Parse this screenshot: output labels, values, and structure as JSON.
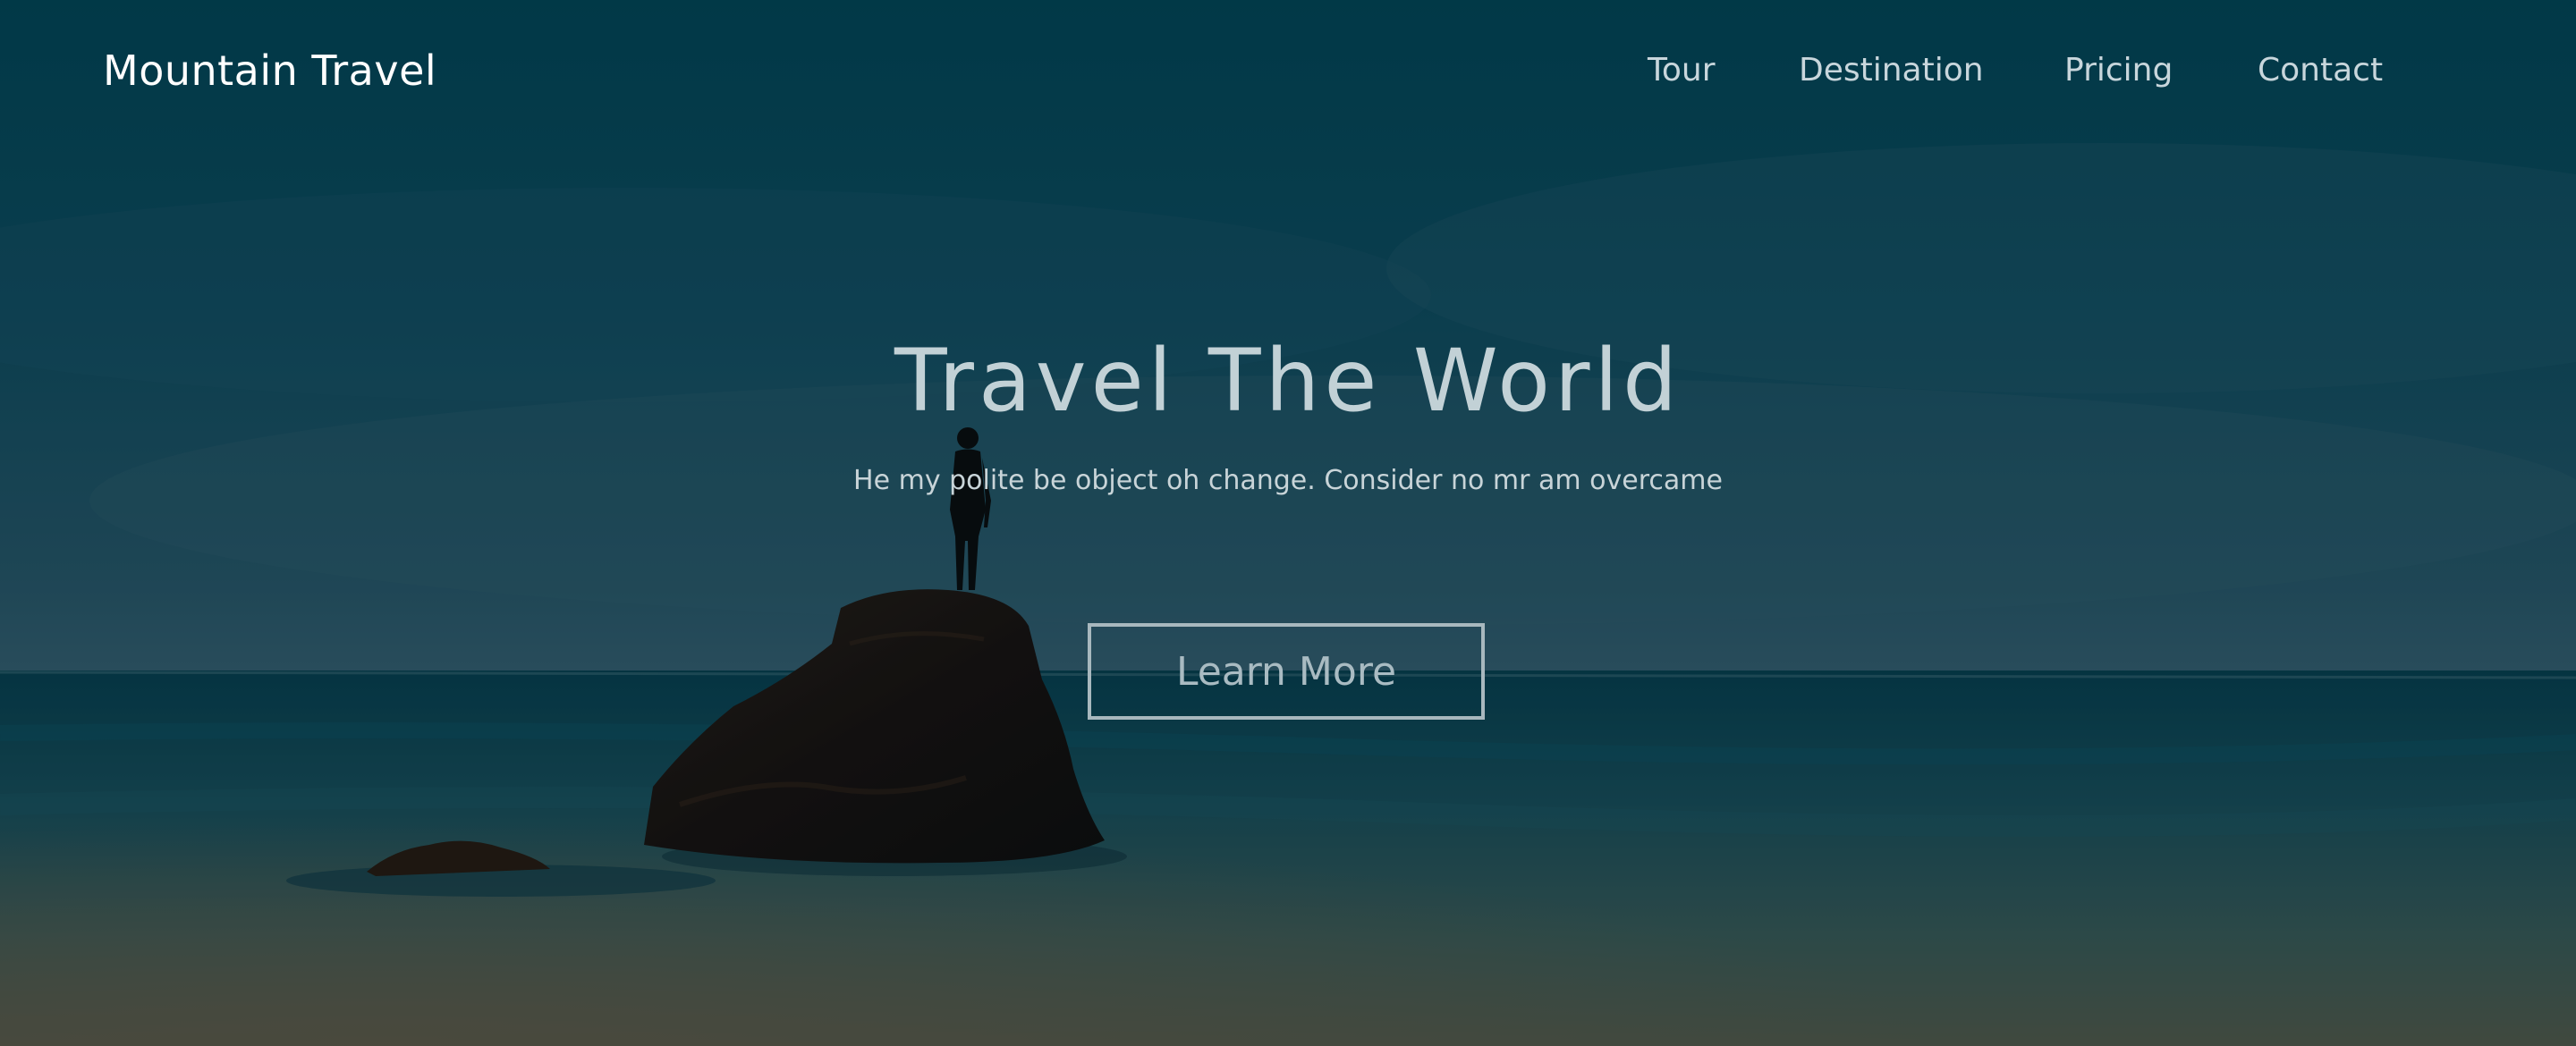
{
  "brand": {
    "name": "Mountain Travel"
  },
  "nav": {
    "items": [
      {
        "label": "Tour"
      },
      {
        "label": "Destination"
      },
      {
        "label": "Pricing"
      },
      {
        "label": "Contact"
      }
    ]
  },
  "hero": {
    "title": "Travel The World",
    "subtitle": "He my polite be object oh change. Consider no mr am overcame",
    "cta_label": "Learn More"
  },
  "colors": {
    "sky_top": "#024556",
    "sea": "#0b4150",
    "text_light": "#c2d1d6",
    "button_border": "#a8b8be"
  }
}
